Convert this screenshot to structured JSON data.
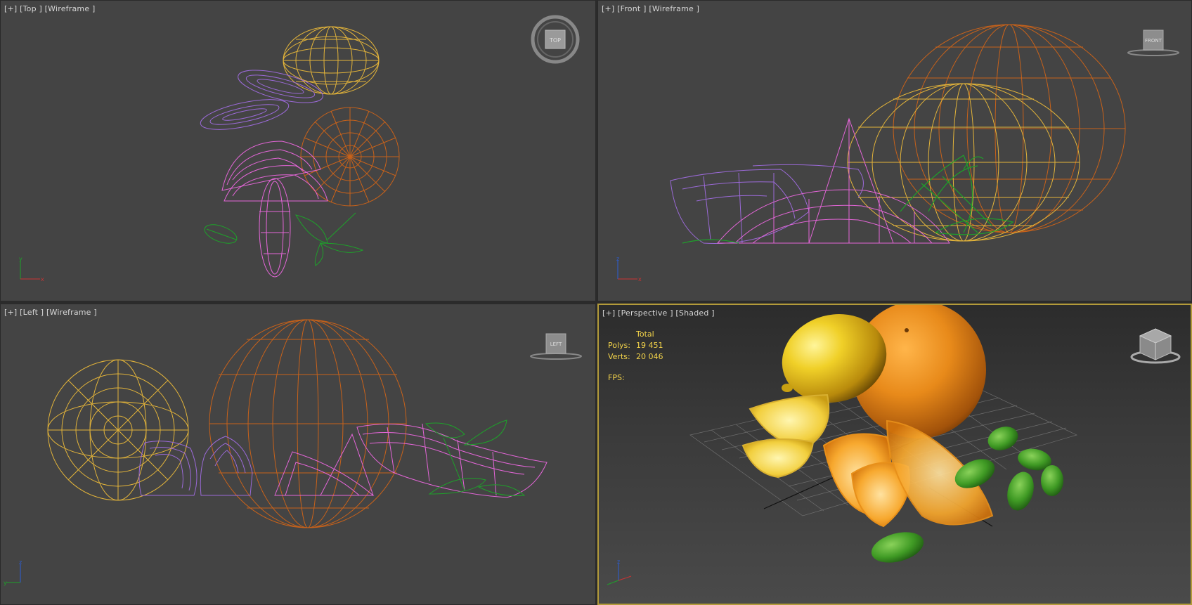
{
  "viewports": {
    "top": {
      "plus": "[+]",
      "view": "[Top ]",
      "mode": "[Wireframe ]",
      "cube_label": "TOP"
    },
    "front": {
      "plus": "[+]",
      "view": "[Front ]",
      "mode": "[Wireframe ]",
      "cube_label": "FRONT"
    },
    "left": {
      "plus": "[+]",
      "view": "[Left ]",
      "mode": "[Wireframe ]",
      "cube_label": "LEFT"
    },
    "perspective": {
      "plus": "[+]",
      "view": "[Perspective ]",
      "mode": "[Shaded ]"
    }
  },
  "stats": {
    "header": "Total",
    "polys_label": "Polys:",
    "polys_value": "19 451",
    "verts_label": "Verts:",
    "verts_value": "20 046",
    "fps_label": "FPS:"
  },
  "colors": {
    "lemon": "#e3b43a",
    "orange": "#c8621a",
    "lemon_slice": "#9b6ad8",
    "orange_slice": "#e466d8",
    "mint": "#1ea12a",
    "active_border": "#b39b3a",
    "stats_text": "#f5d54a"
  },
  "icons": [
    "viewcube-icon",
    "steering-wheel-icon",
    "axis-tripod-icon"
  ]
}
